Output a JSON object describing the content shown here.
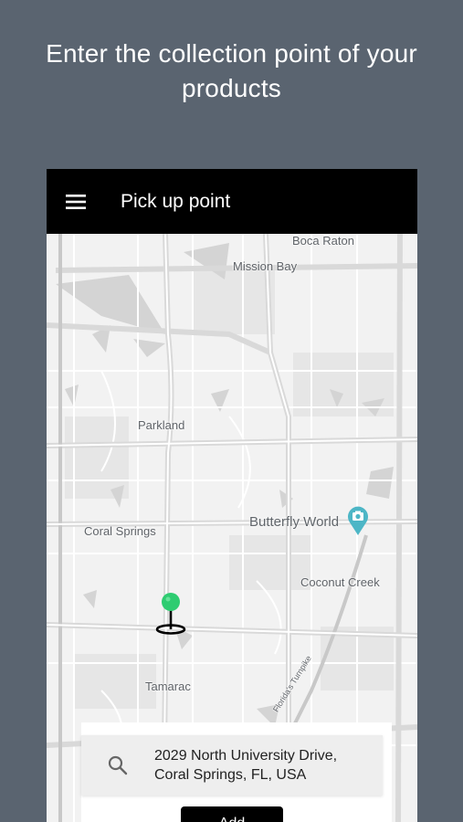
{
  "headline": "Enter the collection point of your products",
  "appbar": {
    "title": "Pick up point",
    "menu_icon": "hamburger-menu-icon"
  },
  "map": {
    "labels": {
      "boca_raton": "Boca Raton",
      "mission_bay": "Mission Bay",
      "parkland": "Parkland",
      "coral_springs": "Coral Springs",
      "butterfly_world": "Butterfly World",
      "coconut_creek": "Coconut Creek",
      "tamarac": "Tamarac",
      "turnpike": "Florida's Turnpike"
    },
    "poi_icon": "camera-poi-icon",
    "poi_color": "#4db6c6",
    "pin_icon": "location-pin-icon",
    "pin_color": "#2ecc71"
  },
  "search": {
    "icon": "search-icon",
    "address_line1": "2029 North University Drive,",
    "address_line2": "Coral Springs, FL, USA"
  },
  "confirm_button": {
    "label": "Add"
  }
}
